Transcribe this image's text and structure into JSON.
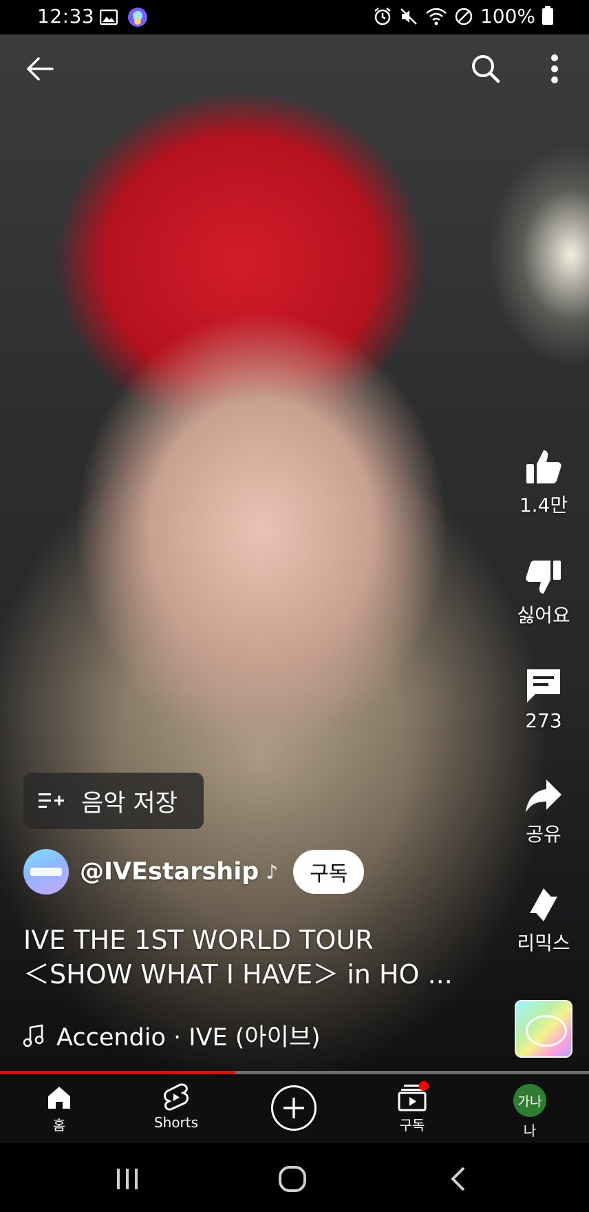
{
  "status_bar": {
    "time": "12:33",
    "battery": "100%",
    "icons": [
      "image-icon",
      "app-badge-icon",
      "alarm-icon",
      "mute-icon",
      "wifi-icon",
      "do-not-disturb-icon",
      "battery-icon"
    ]
  },
  "topbar": {
    "icons": [
      "back-arrow-icon",
      "search-icon",
      "more-vert-icon"
    ]
  },
  "actions": {
    "like_count": "1.4만",
    "dislike_label": "싫어요",
    "comment_count": "273",
    "share_label": "공유",
    "remix_label": "리믹스"
  },
  "save_music": {
    "label": "음악 저장"
  },
  "channel": {
    "handle": "@IVEstarship",
    "note_icon": "♪",
    "subscribe_label": "구독"
  },
  "video": {
    "title_line1": "IVE THE 1ST WORLD TOUR",
    "title_line2": "＜SHOW WHAT I HAVE＞ in HO ...",
    "music": "Accendio · IVE (아이브)",
    "progress_fraction": 0.4
  },
  "bottom_nav": {
    "home_label": "홈",
    "shorts_label": "Shorts",
    "subscriptions_label": "구독",
    "me_label": "나",
    "me_avatar_text": "가나"
  },
  "colors": {
    "accent": "#ff0000",
    "nav_bg": "#0f0f0f",
    "avatar_green": "#2e7d32"
  }
}
